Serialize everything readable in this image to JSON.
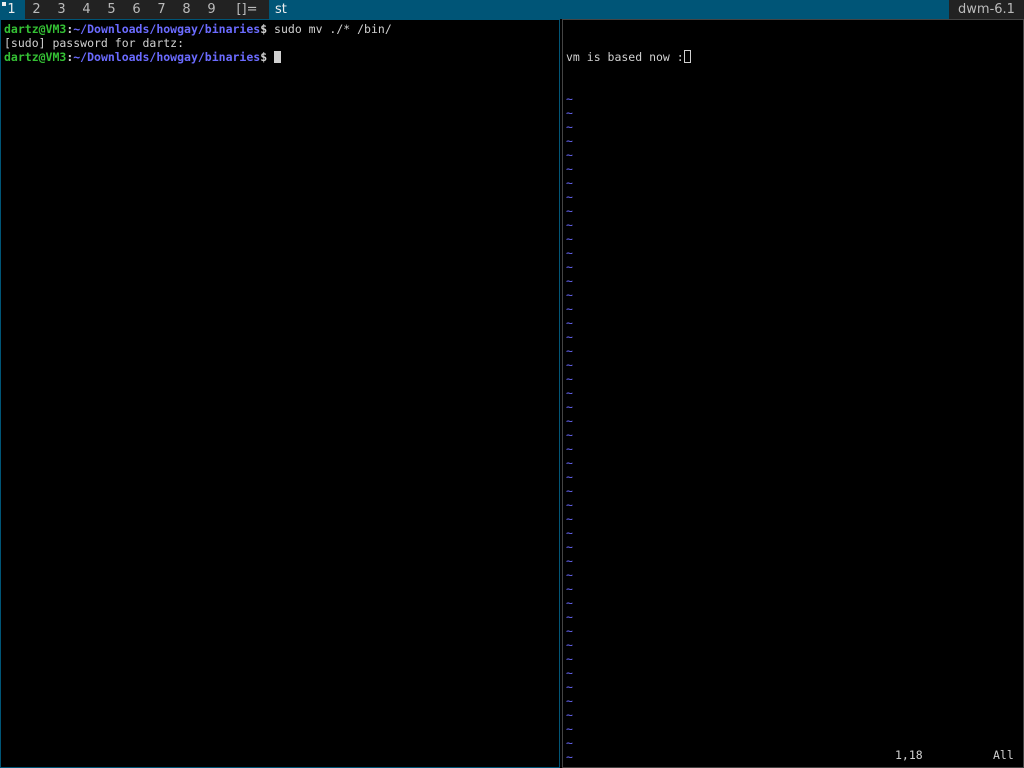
{
  "bar": {
    "tags": [
      {
        "label": "1",
        "selected": true,
        "occupied": true
      },
      {
        "label": "2",
        "selected": false,
        "occupied": false
      },
      {
        "label": "3",
        "selected": false,
        "occupied": false
      },
      {
        "label": "4",
        "selected": false,
        "occupied": false
      },
      {
        "label": "5",
        "selected": false,
        "occupied": false
      },
      {
        "label": "6",
        "selected": false,
        "occupied": false
      },
      {
        "label": "7",
        "selected": false,
        "occupied": false
      },
      {
        "label": "8",
        "selected": false,
        "occupied": false
      },
      {
        "label": "9",
        "selected": false,
        "occupied": false
      }
    ],
    "layout_symbol": "[]=",
    "window_title": "st",
    "status_text": "dwm-6.1"
  },
  "terminal": {
    "prompt": {
      "user_host": "dartz@VM3",
      "separator": ":",
      "path": "~/Downloads/howgay/binaries",
      "symbol": "$"
    },
    "lines": [
      {
        "type": "prompt",
        "command": " sudo mv ./* /bin/"
      },
      {
        "type": "output",
        "text": "[sudo] password for dartz:"
      },
      {
        "type": "prompt",
        "command": " "
      }
    ]
  },
  "vim": {
    "first_line": "vm is based now :",
    "tilde_char": "~",
    "tilde_count": 51,
    "cursor_position": "1,18",
    "view_range": "All"
  },
  "colors": {
    "bar_bg": "#222222",
    "selected_bg": "#005577",
    "prompt_user": "#34c134",
    "prompt_path": "#6b6bff",
    "vim_tilde": "#6b6bff"
  }
}
